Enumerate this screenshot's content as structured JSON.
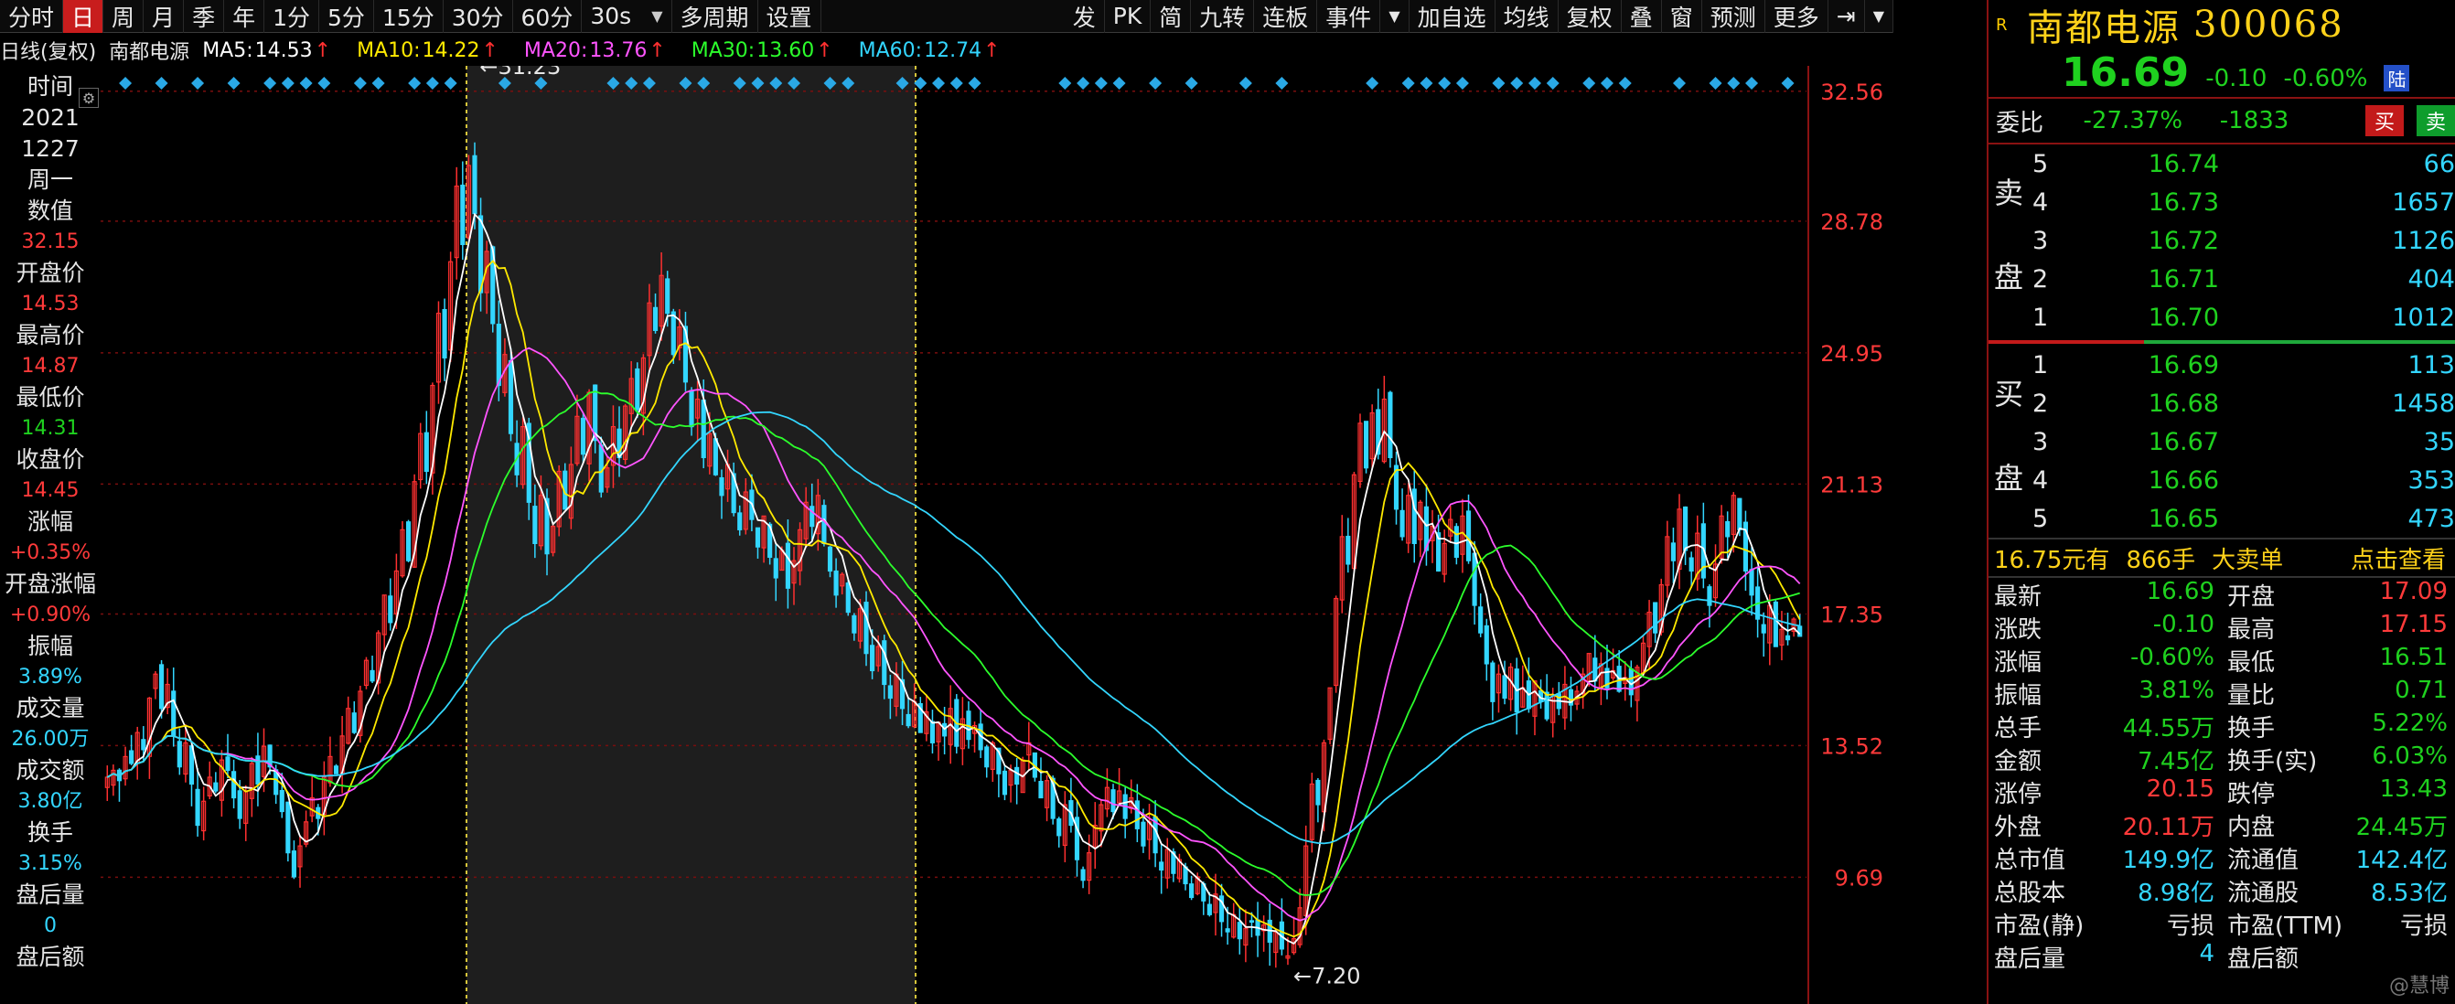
{
  "toolbar": {
    "left_items": [
      "分时",
      "日",
      "周",
      "月",
      "季",
      "年",
      "1分",
      "5分",
      "15分",
      "30分",
      "60分"
    ],
    "active": "日",
    "interval_select": "30s",
    "right_items": [
      "多周期",
      "设置"
    ],
    "right_group": [
      "发",
      "PK",
      "简",
      "九转",
      "连板",
      "事件"
    ],
    "right_group2": [
      "加自选",
      "均线",
      "复权",
      "叠",
      "窗",
      "预测",
      "更多"
    ]
  },
  "ma_legend": {
    "prefix": "日线(复权)",
    "stock": "南都电源",
    "items": [
      {
        "label": "MA5:",
        "value": "14.53",
        "color": "#ffffff"
      },
      {
        "label": "MA10:",
        "value": "14.22",
        "color": "#ffea00"
      },
      {
        "label": "MA20:",
        "value": "13.76",
        "color": "#ff55ff"
      },
      {
        "label": "MA30:",
        "value": "13.60",
        "color": "#2cff2c"
      },
      {
        "label": "MA60:",
        "value": "12.74",
        "color": "#33d6ff"
      }
    ]
  },
  "left_column": [
    {
      "label": "时间",
      "value": "",
      "cls": ""
    },
    {
      "label": "2021",
      "value": "",
      "cls": ""
    },
    {
      "label": "1227",
      "value": "",
      "cls": ""
    },
    {
      "label": "周一",
      "value": "",
      "cls": ""
    },
    {
      "label": "数值",
      "value": "32.15",
      "cls": ""
    },
    {
      "label": "开盘价",
      "value": "14.53",
      "cls": ""
    },
    {
      "label": "最高价",
      "value": "14.87",
      "cls": ""
    },
    {
      "label": "最低价",
      "value": "14.31",
      "cls": "green"
    },
    {
      "label": "收盘价",
      "value": "14.45",
      "cls": ""
    },
    {
      "label": "涨幅",
      "value": "+0.35%",
      "cls": ""
    },
    {
      "label": "开盘涨幅",
      "value": "+0.90%",
      "cls": ""
    },
    {
      "label": "振幅",
      "value": "3.89%",
      "cls": "cyan"
    },
    {
      "label": "成交量",
      "value": "26.00万",
      "cls": "cyan"
    },
    {
      "label": "成交额",
      "value": "3.80亿",
      "cls": "cyan"
    },
    {
      "label": "换手",
      "value": "3.15%",
      "cls": "cyan"
    },
    {
      "label": "盘后量",
      "value": "0",
      "cls": "cyan"
    },
    {
      "label": "盘后额",
      "value": "",
      "cls": ""
    }
  ],
  "chart_data": {
    "type": "candlestick",
    "y_ticks": [
      32.56,
      28.78,
      24.95,
      21.13,
      17.35,
      13.52,
      9.69
    ],
    "ylim": [
      6.0,
      33.3
    ],
    "high_label": "31.23",
    "low_label": "7.20",
    "moving_averages": [
      "MA5",
      "MA10",
      "MA20",
      "MA30",
      "MA60"
    ],
    "colors": {
      "up": "#ff3030",
      "down": "#33d6ff",
      "ma5": "#ffffff",
      "ma10": "#ffea00",
      "ma20": "#ff55ff",
      "ma30": "#2cff2c",
      "ma60": "#33d6ff",
      "grid": "#7a0e0e",
      "axis": "#ff3a3a"
    },
    "closes": [
      12.6,
      12.8,
      12.5,
      13.2,
      13.0,
      13.9,
      13.4,
      14.9,
      15.6,
      14.6,
      15.3,
      13.8,
      12.9,
      13.6,
      12.4,
      11.2,
      11.9,
      12.6,
      12.2,
      13.1,
      12.8,
      12.0,
      11.4,
      12.2,
      13.0,
      12.4,
      13.5,
      12.9,
      12.1,
      11.6,
      10.4,
      9.7,
      10.6,
      11.3,
      12.0,
      11.4,
      12.6,
      13.2,
      12.7,
      13.8,
      14.6,
      13.9,
      15.1,
      16.0,
      15.4,
      16.8,
      17.9,
      17.1,
      18.6,
      19.8,
      18.9,
      21.2,
      22.6,
      21.5,
      24.0,
      26.1,
      24.8,
      27.6,
      29.8,
      28.1,
      30.4,
      29.0,
      26.7,
      27.9,
      25.8,
      24.0,
      24.9,
      22.6,
      21.4,
      22.8,
      20.6,
      19.4,
      20.8,
      19.1,
      19.9,
      21.5,
      20.4,
      21.7,
      23.1,
      22.0,
      23.8,
      22.4,
      20.9,
      21.6,
      22.8,
      21.9,
      23.4,
      24.2,
      23.3,
      24.8,
      26.4,
      25.6,
      27.2,
      26.1,
      24.9,
      25.7,
      24.1,
      22.8,
      23.6,
      21.9,
      22.6,
      21.4,
      20.8,
      21.7,
      20.3,
      19.8,
      20.9,
      20.1,
      19.3,
      20.2,
      19.0,
      18.4,
      19.2,
      18.1,
      18.9,
      19.8,
      20.6,
      19.9,
      20.8,
      19.4,
      18.6,
      17.9,
      18.5,
      17.4,
      16.8,
      17.5,
      16.2,
      15.7,
      16.4,
      15.3,
      14.9,
      15.6,
      14.6,
      14.1,
      14.8,
      13.9,
      14.5,
      13.6,
      14.2,
      13.8,
      14.6,
      13.5,
      14.3,
      13.7,
      14.1,
      13.4,
      12.9,
      13.6,
      12.7,
      12.1,
      12.8,
      12.4,
      13.1,
      13.6,
      12.6,
      12.0,
      12.5,
      11.4,
      10.9,
      11.8,
      11.2,
      10.2,
      9.6,
      10.4,
      11.2,
      11.8,
      12.3,
      11.6,
      12.2,
      11.4,
      12.0,
      11.1,
      10.6,
      11.3,
      10.4,
      9.9,
      10.5,
      9.8,
      10.2,
      9.5,
      9.1,
      9.7,
      9.0,
      8.6,
      9.2,
      8.4,
      8.1,
      8.6,
      7.9,
      8.2,
      8.4,
      8.0,
      8.3,
      7.8,
      8.1,
      7.6,
      7.4,
      7.9,
      8.8,
      10.6,
      12.4,
      11.8,
      13.6,
      15.2,
      17.8,
      19.6,
      18.8,
      21.4,
      22.9,
      21.6,
      23.2,
      22.0,
      23.6,
      21.9,
      20.4,
      19.6,
      20.8,
      19.4,
      20.6,
      19.2,
      19.9,
      18.6,
      19.4,
      20.1,
      19.0,
      20.2,
      18.9,
      17.6,
      16.8,
      15.9,
      14.8,
      15.6,
      14.9,
      15.8,
      14.5,
      15.2,
      14.6,
      15.4,
      14.8,
      14.3,
      15.0,
      14.6,
      15.3,
      14.7,
      15.1,
      15.6,
      16.2,
      15.4,
      15.9,
      15.2,
      15.7,
      15.1,
      15.5,
      15.0,
      15.8,
      16.5,
      17.4,
      16.8,
      18.2,
      19.6,
      18.9,
      20.4,
      19.2,
      18.6,
      19.7,
      18.4,
      17.6,
      18.8,
      20.2,
      19.6,
      20.8,
      19.8,
      18.6,
      17.9,
      17.2,
      16.8,
      17.6,
      16.4,
      16.9,
      16.6,
      17.2,
      16.7
    ]
  },
  "right_panel": {
    "r_tag": "R",
    "name": "南都电源",
    "code": "300068",
    "price": "16.69",
    "change": "-0.10",
    "change_pct": "-0.60%",
    "lu_tag": "陆",
    "weibi_label": "委比",
    "weibi_pct": "-27.37%",
    "weibi_val": "-1833",
    "buy_btn": "买",
    "sell_btn": "卖",
    "ask_side": "卖盘",
    "bid_side": "买盘",
    "asks": [
      {
        "lv": "5",
        "px": "16.74",
        "vol": "66"
      },
      {
        "lv": "4",
        "px": "16.73",
        "vol": "1657"
      },
      {
        "lv": "3",
        "px": "16.72",
        "vol": "1126"
      },
      {
        "lv": "2",
        "px": "16.71",
        "vol": "404"
      },
      {
        "lv": "1",
        "px": "16.70",
        "vol": "1012"
      }
    ],
    "bids": [
      {
        "lv": "1",
        "px": "16.69",
        "vol": "113"
      },
      {
        "lv": "2",
        "px": "16.68",
        "vol": "1458"
      },
      {
        "lv": "3",
        "px": "16.67",
        "vol": "35"
      },
      {
        "lv": "4",
        "px": "16.66",
        "vol": "353"
      },
      {
        "lv": "5",
        "px": "16.65",
        "vol": "473"
      }
    ],
    "big_order": {
      "a": "16.75元有",
      "b": "866手",
      "c": "大卖单",
      "d": "点击查看"
    },
    "stats": [
      [
        {
          "k": "最新",
          "v": "16.69",
          "c": ""
        },
        {
          "k": "开盘",
          "v": "17.09",
          "c": "red"
        }
      ],
      [
        {
          "k": "涨跌",
          "v": "-0.10",
          "c": ""
        },
        {
          "k": "最高",
          "v": "17.15",
          "c": "red"
        }
      ],
      [
        {
          "k": "涨幅",
          "v": "-0.60%",
          "c": ""
        },
        {
          "k": "最低",
          "v": "16.51",
          "c": ""
        }
      ],
      [
        {
          "k": "振幅",
          "v": "3.81%",
          "c": ""
        },
        {
          "k": "量比",
          "v": "0.71",
          "c": ""
        }
      ],
      [
        {
          "k": "总手",
          "v": "44.55万",
          "c": ""
        },
        {
          "k": "换手",
          "v": "5.22%",
          "c": ""
        }
      ],
      [
        {
          "k": "金额",
          "v": "7.45亿",
          "c": ""
        },
        {
          "k": "换手(实)",
          "v": "6.03%",
          "c": ""
        }
      ],
      [
        {
          "k": "涨停",
          "v": "20.15",
          "c": "red"
        },
        {
          "k": "跌停",
          "v": "13.43",
          "c": ""
        }
      ],
      [
        {
          "k": "外盘",
          "v": "20.11万",
          "c": "red"
        },
        {
          "k": "内盘",
          "v": "24.45万",
          "c": ""
        }
      ],
      [
        {
          "k": "总市值",
          "v": "149.9亿",
          "c": "cyan"
        },
        {
          "k": "流通值",
          "v": "142.4亿",
          "c": "cyan"
        }
      ],
      [
        {
          "k": "总股本",
          "v": "8.98亿",
          "c": "cyan"
        },
        {
          "k": "流通股",
          "v": "8.53亿",
          "c": "cyan"
        }
      ],
      [
        {
          "k": "市盈(静)",
          "v": "亏损",
          "c": "white"
        },
        {
          "k": "市盈(TTM)",
          "v": "亏损",
          "c": "white"
        }
      ],
      [
        {
          "k": "盘后量",
          "v": "4",
          "c": "cyan"
        },
        {
          "k": "盘后额",
          "v": "",
          "c": ""
        }
      ]
    ],
    "watermark": "@慧博"
  }
}
